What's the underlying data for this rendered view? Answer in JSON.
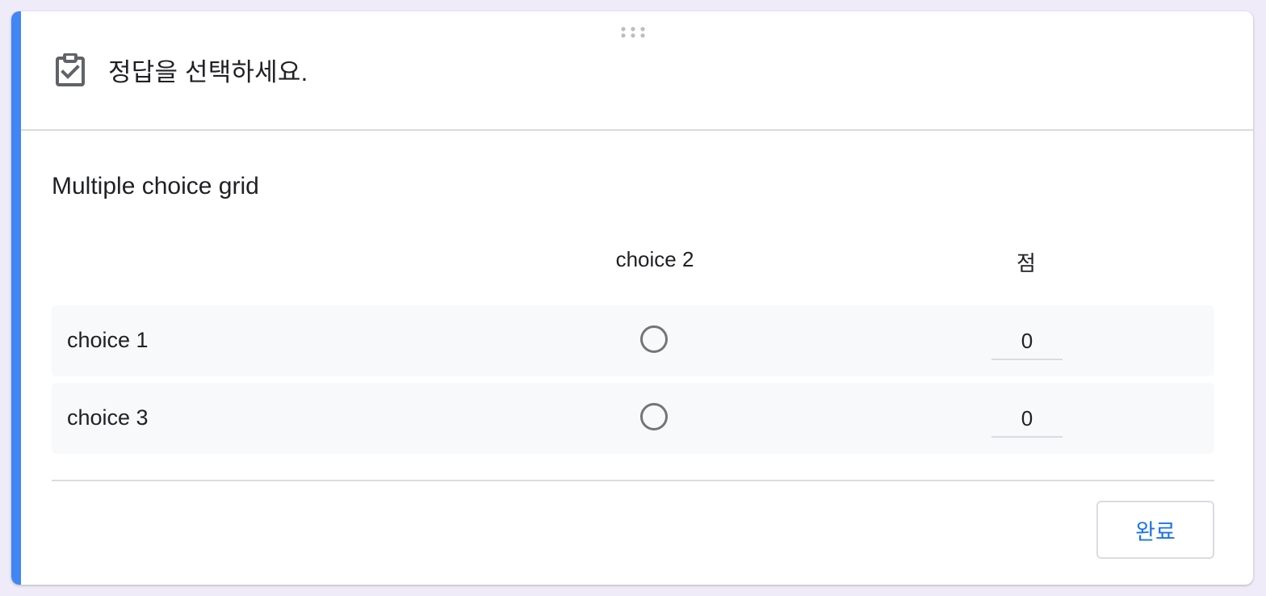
{
  "header": {
    "title": "정답을 선택하세요.",
    "icon": "assignment-check-icon"
  },
  "grid": {
    "title": "Multiple choice grid",
    "columns": {
      "choice_header": "choice 2",
      "points_header": "점"
    },
    "rows": [
      {
        "label": "choice 1",
        "selected": false,
        "points": "0"
      },
      {
        "label": "choice 3",
        "selected": false,
        "points": "0"
      }
    ]
  },
  "footer": {
    "done_label": "완료"
  },
  "colors": {
    "accent": "#4285f4",
    "background": "#f0ebf8",
    "button_text": "#1a73e8",
    "radio_border": "#757575",
    "row_background": "#f8f9fa"
  }
}
